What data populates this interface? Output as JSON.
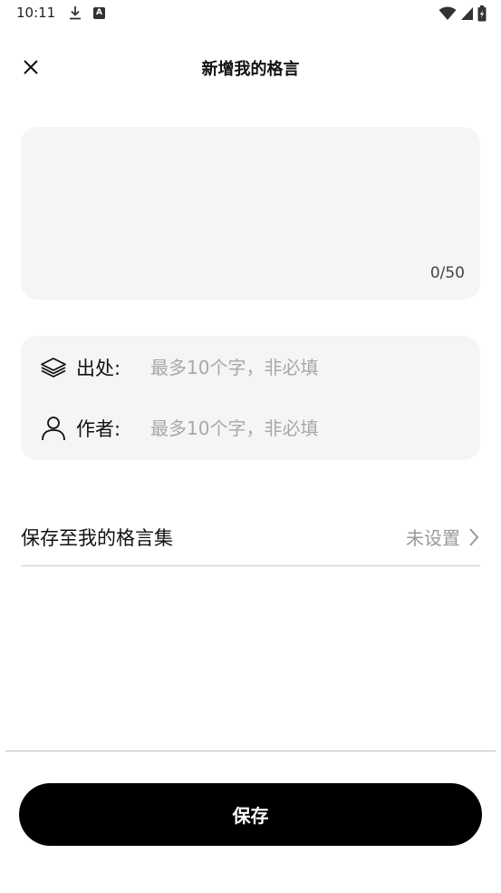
{
  "status_bar": {
    "time": "10:11",
    "icons": [
      "download-icon",
      "a-notification-icon",
      "wifi-icon",
      "signal-icon",
      "battery-icon"
    ]
  },
  "header": {
    "title": "新增我的格言",
    "close_icon": "close-icon"
  },
  "quote": {
    "value": "",
    "placeholder": "",
    "count": "0/50"
  },
  "source": {
    "icon": "layers-icon",
    "label": "出处:",
    "placeholder": "最多10个字，非必填",
    "value": ""
  },
  "author": {
    "icon": "person-icon",
    "label": "作者:",
    "placeholder": "最多10个字，非必填",
    "value": ""
  },
  "collection": {
    "label": "保存至我的格言集",
    "value": "未设置",
    "icon": "chevron-right-icon"
  },
  "save_button": {
    "label": "保存"
  },
  "colors": {
    "background": "#ffffff",
    "card": "#f5f5f5",
    "button": "#000000",
    "placeholder": "#a8a8a8"
  }
}
